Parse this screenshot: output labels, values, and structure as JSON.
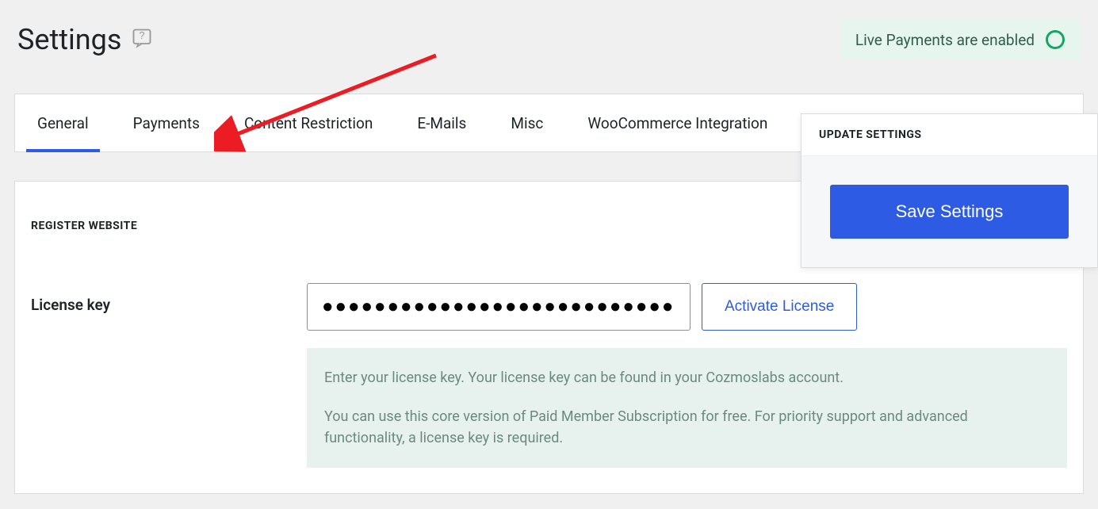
{
  "page": {
    "title": "Settings"
  },
  "status": {
    "text": "Live Payments are enabled"
  },
  "tabs": {
    "general": "General",
    "payments": "Payments",
    "content_restriction": "Content Restriction",
    "emails": "E-Mails",
    "misc": "Misc",
    "woocommerce": "WooCommerce Integration"
  },
  "register": {
    "section_title": "REGISTER WEBSITE",
    "license_label": "License key",
    "license_value": "●●●●●●●●●●●●●●●●●●●●●●●●●●●●●●●●",
    "activate_label": "Activate License",
    "help_line1": "Enter your license key. Your license key can be found in your Cozmoslabs account.",
    "help_line2": "You can use this core version of Paid Member Subscription for free. For priority support and advanced functionality, a license key is required."
  },
  "update_panel": {
    "heading": "UPDATE SETTINGS",
    "save_label": "Save Settings"
  }
}
